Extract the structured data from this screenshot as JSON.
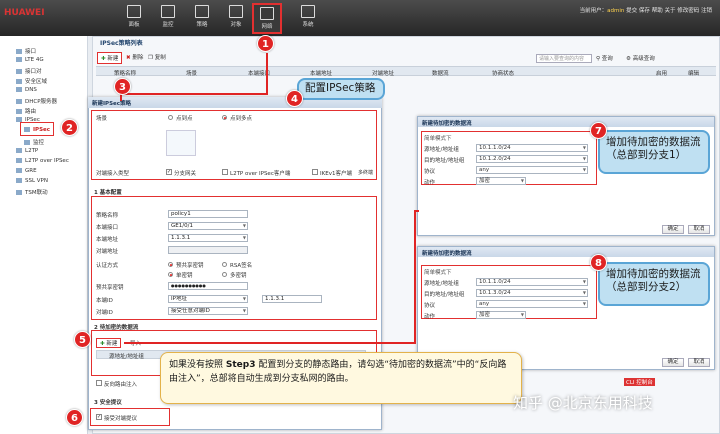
{
  "app": {
    "logo": "HUAWEI"
  },
  "topnav": [
    {
      "label": "面板",
      "icon": "dashboard-icon"
    },
    {
      "label": "监控",
      "icon": "monitor-icon"
    },
    {
      "label": "策略",
      "icon": "policy-icon"
    },
    {
      "label": "对象",
      "icon": "object-icon"
    },
    {
      "label": "网络",
      "icon": "network-icon"
    },
    {
      "label": "系统",
      "icon": "system-icon"
    }
  ],
  "top_right": {
    "user_label": "当前用户：",
    "user": "admin",
    "links": [
      "提交",
      "保存",
      "帮助",
      "关于",
      "修改密码",
      "注销"
    ]
  },
  "sidebar": {
    "items": [
      "接口",
      "LTE 4G",
      "接口对",
      "安全区域",
      "DNS",
      "DHCP服务器",
      "路由",
      "IPSec",
      "IPSec",
      "监控",
      "L2TP",
      "L2TP over IPSec",
      "GRE",
      "SSL VPN",
      "TSM联动"
    ]
  },
  "main": {
    "title": "IPSec策略列表",
    "toolbar": {
      "new": "新建",
      "delete": "删除",
      "copy": "复制",
      "search_placeholder": "请输入要查询的内容",
      "search": "查询",
      "advanced": "高级查询"
    },
    "columns": [
      "策略名称",
      "场景",
      "本端接口",
      "本端地址",
      "对端地址",
      "数据流",
      "协商状态",
      "启用",
      "编辑"
    ]
  },
  "dialog": {
    "title": "新建IPSec策略",
    "scenario_label": "场景",
    "scenario_options": [
      "点到点",
      "点到多点"
    ],
    "scenario_desc": [
      "",
      "",
      ""
    ],
    "peer_type_label": "对端接入类型",
    "peer_types": [
      "分支网关",
      "L2TP over IPSec客户端",
      "IKEv1客户端",
      "多终端"
    ],
    "basic_section": "1 基本配置",
    "fields": [
      {
        "label": "策略名称",
        "value": "policy1"
      },
      {
        "label": "本端接口",
        "value": "GE1/0/1"
      },
      {
        "label": "本端地址",
        "value": "1.1.3.1"
      },
      {
        "label": "对端地址",
        "value": ""
      },
      {
        "label": "认证方式",
        "value": ""
      },
      {
        "label": "预共享密钥",
        "value": "●●●●●●●●●●"
      },
      {
        "label": "本端ID",
        "value": "IP地址"
      },
      {
        "label": "对端ID",
        "value": "接受任意对端ID"
      }
    ],
    "auth_options": [
      "预共享密钥",
      "RSA签名"
    ],
    "auth_type_options": [
      "单密钥",
      "多密钥"
    ],
    "local_id_ip": "1.1.3.1",
    "flow_section": "2 待加密的数据流",
    "flow_new": "新建",
    "flow_import": "导入",
    "flow_col": "源地址/地址组",
    "reverse_route": "反向路由注入",
    "security_section": "3 安全提议",
    "accept_proposal": "接受对端提议"
  },
  "flow_dialog_1": {
    "title": "新建待加密的数据流",
    "hint": "简单模式下",
    "fields": [
      {
        "label": "源地址/地址组",
        "value": "10.1.1.0/24"
      },
      {
        "label": "目的地址/地址组",
        "value": "10.1.2.0/24"
      },
      {
        "label": "协议",
        "value": "any"
      },
      {
        "label": "动作",
        "value": "加密"
      }
    ],
    "ok": "确定",
    "cancel": "取消"
  },
  "flow_dialog_2": {
    "title": "新建待加密的数据流",
    "hint": "简单模式下",
    "fields": [
      {
        "label": "源地址/地址组",
        "value": "10.1.1.0/24"
      },
      {
        "label": "目的地址/地址组",
        "value": "10.1.3.0/24"
      },
      {
        "label": "协议",
        "value": "any"
      },
      {
        "label": "动作",
        "value": "加密"
      }
    ],
    "ok": "确定",
    "cancel": "取消"
  },
  "annotations": {
    "badges": [
      "1",
      "2",
      "3",
      "4",
      "5",
      "6",
      "7",
      "8"
    ],
    "callout_policy": "配置IPSec策略",
    "callout_flow1": "增加待加密的数据流（总部到分支1）",
    "callout_flow2": "增加待加密的数据流（总部到分支2）",
    "note_pre": "如果没有按照 ",
    "note_step": "Step3",
    "note_post": " 配置到分支的静态路由，请勾选“待加密的数据流”中的“反向路由注入”，总部将自动生成到分支私网的路由。",
    "watermark": "知乎 @北京东用科技",
    "cli": "CLI 控制台"
  }
}
